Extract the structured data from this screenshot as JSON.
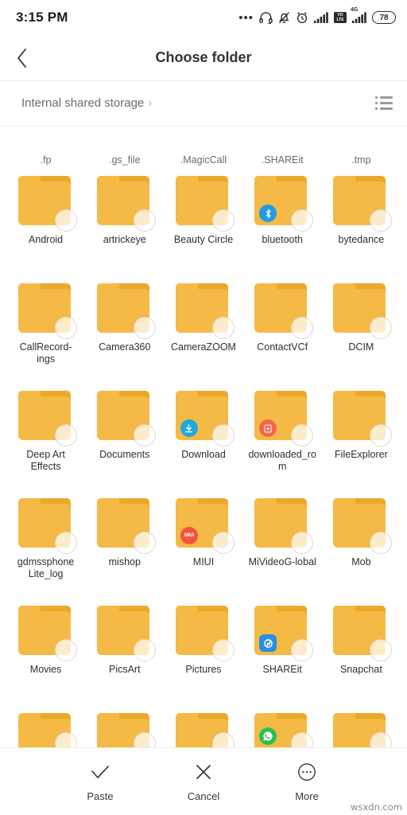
{
  "statusbar": {
    "time": "3:15 PM",
    "icons": [
      {
        "name": "more-dots-icon",
        "glyph": "•••"
      },
      {
        "name": "headset-icon"
      },
      {
        "name": "bell-muted-icon"
      },
      {
        "name": "alarm-clock-icon"
      },
      {
        "name": "signal-bars-icon"
      },
      {
        "name": "volte-icon",
        "line1": "VO",
        "line2": "LTE"
      },
      {
        "name": "signal-4g-icon",
        "label": "4G"
      },
      {
        "name": "battery-icon",
        "level": "78"
      }
    ],
    "battery_level": "78",
    "volte_top": "VO",
    "volte_bottom": "LTE",
    "network_label": "4G",
    "dots": "•••"
  },
  "titlebar": {
    "back_label": "‹",
    "title": "Choose folder"
  },
  "breadcrumb": {
    "path": "Internal shared storage",
    "chevron": "›",
    "view_toggle": "list-view-icon"
  },
  "grid": {
    "clipped_top_row": [
      {
        "name": ".fp"
      },
      {
        "name": ".gs_file"
      },
      {
        "name": ".MagicCall"
      },
      {
        "name": ".SHAREit"
      },
      {
        "name": ".tmp"
      }
    ],
    "items": [
      {
        "name": "Android",
        "badge": null
      },
      {
        "name": "artrickeye",
        "badge": null
      },
      {
        "name": "Beauty Circle",
        "badge": null
      },
      {
        "name": "bluetooth",
        "badge": {
          "type": "bluetooth-icon",
          "shape": "circle",
          "color": "#1e9be9",
          "glyph": "✦"
        }
      },
      {
        "name": "bytedance",
        "badge": null
      },
      {
        "name": "CallRecord-\nings",
        "badge": null
      },
      {
        "name": "Camera360",
        "badge": null
      },
      {
        "name": "CameraZOOM",
        "badge": null
      },
      {
        "name": "ContactVCf",
        "badge": null
      },
      {
        "name": "DCIM",
        "badge": null
      },
      {
        "name": "Deep Art Effects",
        "badge": null
      },
      {
        "name": "Documents",
        "badge": null
      },
      {
        "name": "Download",
        "badge": {
          "type": "download-icon",
          "shape": "circle",
          "color": "#21a7e0",
          "glyph": "⤓"
        }
      },
      {
        "name": "downloaded_rom",
        "badge": {
          "type": "rom-file-icon",
          "shape": "circle",
          "color": "#f4664a",
          "glyph": "▣"
        }
      },
      {
        "name": "FileExplorer",
        "badge": null
      },
      {
        "name": "gdmssphone Lite_log",
        "badge": null
      },
      {
        "name": "mishop",
        "badge": null
      },
      {
        "name": "MIUI",
        "badge": {
          "type": "miui-icon",
          "shape": "circle",
          "color": "#f4543c",
          "text": "MIUI"
        }
      },
      {
        "name": "MiVideoG-lobal",
        "badge": null
      },
      {
        "name": "Mob",
        "badge": null
      },
      {
        "name": "Movies",
        "badge": null
      },
      {
        "name": "PicsArt",
        "badge": null
      },
      {
        "name": "Pictures",
        "badge": null
      },
      {
        "name": "SHAREit",
        "badge": {
          "type": "shareit-icon",
          "shape": "rounded",
          "color": "#2a8fe0",
          "glyph": "◐"
        }
      },
      {
        "name": "Snapchat",
        "badge": null
      }
    ],
    "clipped_bottom_row": [
      {
        "name": "",
        "badge": null
      },
      {
        "name": "",
        "badge": null
      },
      {
        "name": "",
        "badge": null
      },
      {
        "name": "",
        "badge": {
          "type": "whatsapp-icon",
          "shape": "circle",
          "color": "#25c152",
          "glyph": ""
        }
      },
      {
        "name": "",
        "badge": null
      }
    ],
    "folder_color": "#f5b945",
    "folder_tab_color": "#eda828"
  },
  "bottombar": {
    "actions": [
      {
        "label": "Paste",
        "icon": "check-icon"
      },
      {
        "label": "Cancel",
        "icon": "close-icon"
      },
      {
        "label": "More",
        "icon": "more-circle-icon"
      }
    ]
  },
  "watermark": "wsxdn.com"
}
